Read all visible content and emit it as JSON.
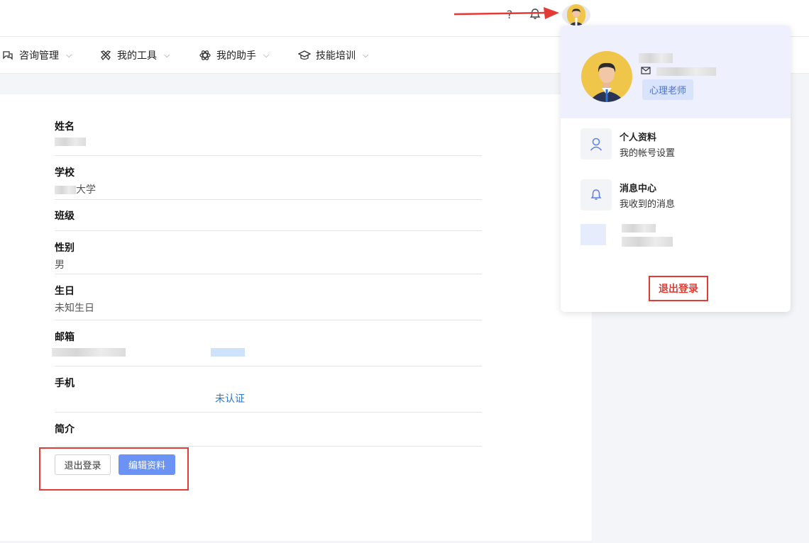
{
  "topbar": {
    "help_icon": "question-icon",
    "bell_icon": "bell-icon"
  },
  "nav": {
    "items": [
      {
        "label": "咨询管理",
        "icon": "chat-icon"
      },
      {
        "label": "我的工具",
        "icon": "tools-icon"
      },
      {
        "label": "我的助手",
        "icon": "atom-icon"
      },
      {
        "label": "技能培训",
        "icon": "graduation-cap-icon"
      }
    ]
  },
  "profile": {
    "fields": [
      {
        "label": "姓名",
        "value": ""
      },
      {
        "label": "学校",
        "value": "大学"
      },
      {
        "label": "班级",
        "value": ""
      },
      {
        "label": "性别",
        "value": "男"
      },
      {
        "label": "生日",
        "value": "未知生日"
      },
      {
        "label": "邮箱",
        "value": ""
      },
      {
        "label": "手机",
        "value": ""
      },
      {
        "label": "简介",
        "value": ""
      }
    ],
    "phone_verify": "未认证",
    "logout_button": "退出登录",
    "edit_button": "编辑资料"
  },
  "dropdown": {
    "role": "心理老师",
    "menu": [
      {
        "title": "个人资料",
        "subtitle": "我的帐号设置",
        "icon": "user-icon"
      },
      {
        "title": "消息中心",
        "subtitle": "我收到的消息",
        "icon": "bell-icon"
      }
    ],
    "logout": "退出登录"
  },
  "colors": {
    "accent": "#6b93f5",
    "danger": "#e53935",
    "link": "#2a78d6"
  }
}
